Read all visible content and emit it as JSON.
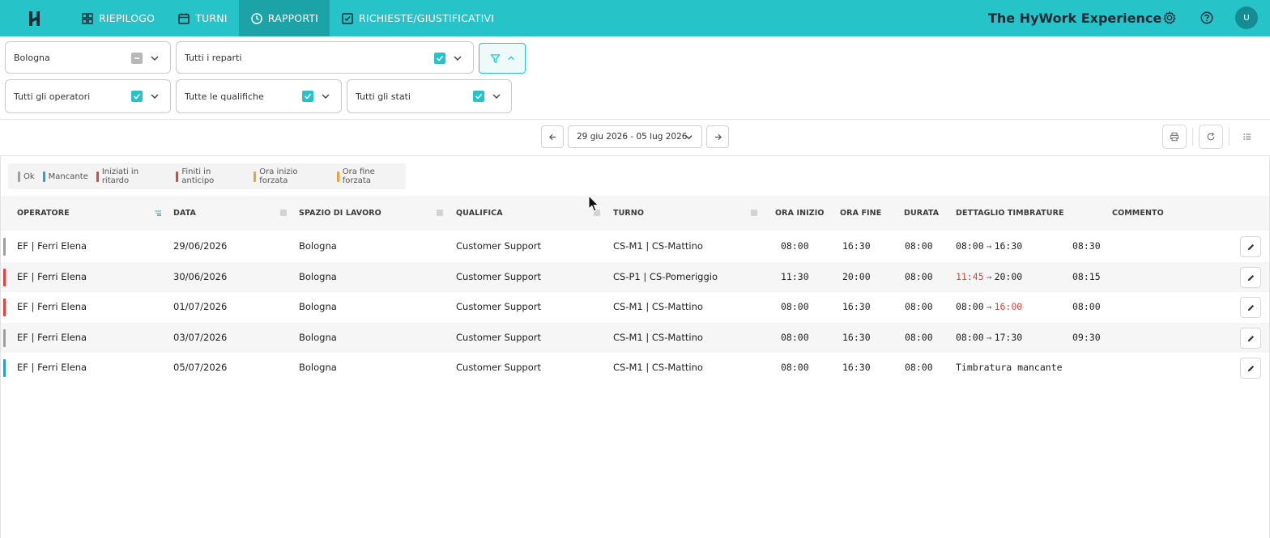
{
  "nav": {
    "items": [
      {
        "label": "RIEPILOGO",
        "icon": "dashboard-icon"
      },
      {
        "label": "TURNI",
        "icon": "calendar-icon"
      },
      {
        "label": "RAPPORTI",
        "icon": "clock-icon"
      },
      {
        "label": "RICHIESTE/GIUSTIFICATIVI",
        "icon": "checkbox-icon"
      }
    ],
    "active": "RAPPORTI"
  },
  "header": {
    "brand": "The HyWork Experience",
    "avatar_initial": "U"
  },
  "filters": {
    "location": "Bologna",
    "departments": "Tutti i reparti",
    "operators": "Tutti gli operatori",
    "qualifications": "Tutte le qualifiche",
    "states": "Tutti gli stati"
  },
  "period": {
    "label": "29 giu 2026 - 05 lug 2026"
  },
  "legend": [
    {
      "label": "Ok",
      "color": "#9e9e9e"
    },
    {
      "label": "Mancante",
      "color": "#2a9fd6"
    },
    {
      "label": "Iniziati in ritardo",
      "color": "#e0443a"
    },
    {
      "label": "Finiti in anticipo",
      "color": "#e0443a"
    },
    {
      "label": "Ora inizio forzata",
      "color": "#f0a030"
    },
    {
      "label": "Ora fine forzata",
      "color": "#f0a030"
    }
  ],
  "table": {
    "columns": {
      "operator": "OPERATORE",
      "date": "DATA",
      "workspace": "SPAZIO DI LAVORO",
      "qualification": "QUALIFICA",
      "shift": "TURNO",
      "start": "ORA INIZIO",
      "end": "ORA FINE",
      "duration": "DURATA",
      "detail": "DETTAGLIO TIMBRATURE",
      "comment": "COMMENTO"
    },
    "rows": [
      {
        "operator": "EF | Ferri Elena",
        "date": "29/06/2026",
        "workspace": "Bologna",
        "qualification": "Customer Support",
        "shift": "CS-M1 | CS-Mattino",
        "start": "08:00",
        "end": "16:30",
        "duration": "08:00",
        "punch_in": "08:00",
        "punch_out": "16:30",
        "worked": "08:30",
        "status_color": "#9e9e9e"
      },
      {
        "operator": "EF | Ferri Elena",
        "date": "30/06/2026",
        "workspace": "Bologna",
        "qualification": "Customer Support",
        "shift": "CS-P1 | CS-Pomeriggio",
        "start": "11:30",
        "end": "20:00",
        "duration": "08:00",
        "punch_in": "11:45",
        "punch_out": "20:00",
        "worked": "08:15",
        "status_color": "#e0443a"
      },
      {
        "operator": "EF | Ferri Elena",
        "date": "01/07/2026",
        "workspace": "Bologna",
        "qualification": "Customer Support",
        "shift": "CS-M1 | CS-Mattino",
        "start": "08:00",
        "end": "16:30",
        "duration": "08:00",
        "punch_in": "08:00",
        "punch_out": "16:00",
        "worked": "08:00",
        "status_color": "#e0443a"
      },
      {
        "operator": "EF | Ferri Elena",
        "date": "03/07/2026",
        "workspace": "Bologna",
        "qualification": "Customer Support",
        "shift": "CS-M1 | CS-Mattino",
        "start": "08:00",
        "end": "16:30",
        "duration": "08:00",
        "punch_in": "08:00",
        "punch_out": "17:30",
        "worked": "09:30",
        "status_color": "#9e9e9e"
      },
      {
        "operator": "EF | Ferri Elena",
        "date": "05/07/2026",
        "workspace": "Bologna",
        "qualification": "Customer Support",
        "shift": "CS-M1 | CS-Mattino",
        "start": "08:00",
        "end": "16:30",
        "duration": "08:00",
        "missing": "Timbratura mancante",
        "status_color": "#2a9fd6"
      }
    ]
  }
}
